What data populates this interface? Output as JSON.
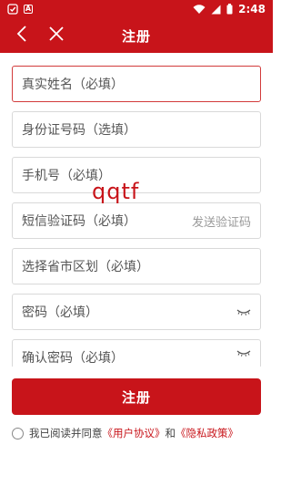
{
  "status_bar": {
    "time": "2:48",
    "left_icons": [
      "notification-icon",
      "a-badge-icon"
    ],
    "right_icons": [
      "wifi-icon",
      "signal-icon",
      "battery-icon"
    ],
    "a_badge": "A"
  },
  "nav": {
    "title": "注册",
    "back_icon": "back-chevron-icon",
    "close_icon": "close-icon"
  },
  "form": {
    "real_name": "真实姓名（必填）",
    "id_number": "身份证号码（选填）",
    "phone": "手机号（必填）",
    "sms_code": "短信验证码（必填）",
    "send_code": "发送验证码",
    "region": "选择省市区划（必填）",
    "password": "密码（必填）",
    "confirm_password": "确认密码（必填）"
  },
  "watermark": "qqtf",
  "submit_label": "注册",
  "agreement": {
    "prefix": "我已阅读并同意",
    "user_agreement": "《用户协议》",
    "and": "和",
    "privacy_policy": "《隐私政策》"
  },
  "colors": {
    "brand_red": "#c8141a",
    "field_border": "#d9d9d9",
    "active_border": "#d23b3b"
  }
}
